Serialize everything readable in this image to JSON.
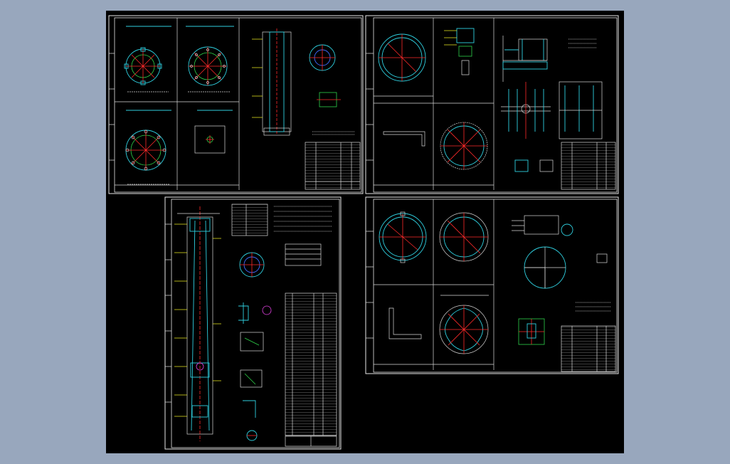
{
  "canvas": {
    "background": "#000000",
    "viewport_background": "#98a7bd"
  },
  "colors": {
    "frame": "#e8e8e8",
    "outline_green": "#2fd34a",
    "outline_cyan": "#2fd0e0",
    "centerline_red": "#ff2a2a",
    "hatch_blue": "#3f6bff",
    "leader_yellow": "#e8e820",
    "accent_magenta": "#e040e0"
  },
  "sheets": [
    {
      "id": "sheet-top-left",
      "label": ""
    },
    {
      "id": "sheet-top-right",
      "label": ""
    },
    {
      "id": "sheet-bottom-left",
      "label": ""
    },
    {
      "id": "sheet-bottom-right",
      "label": ""
    }
  ]
}
